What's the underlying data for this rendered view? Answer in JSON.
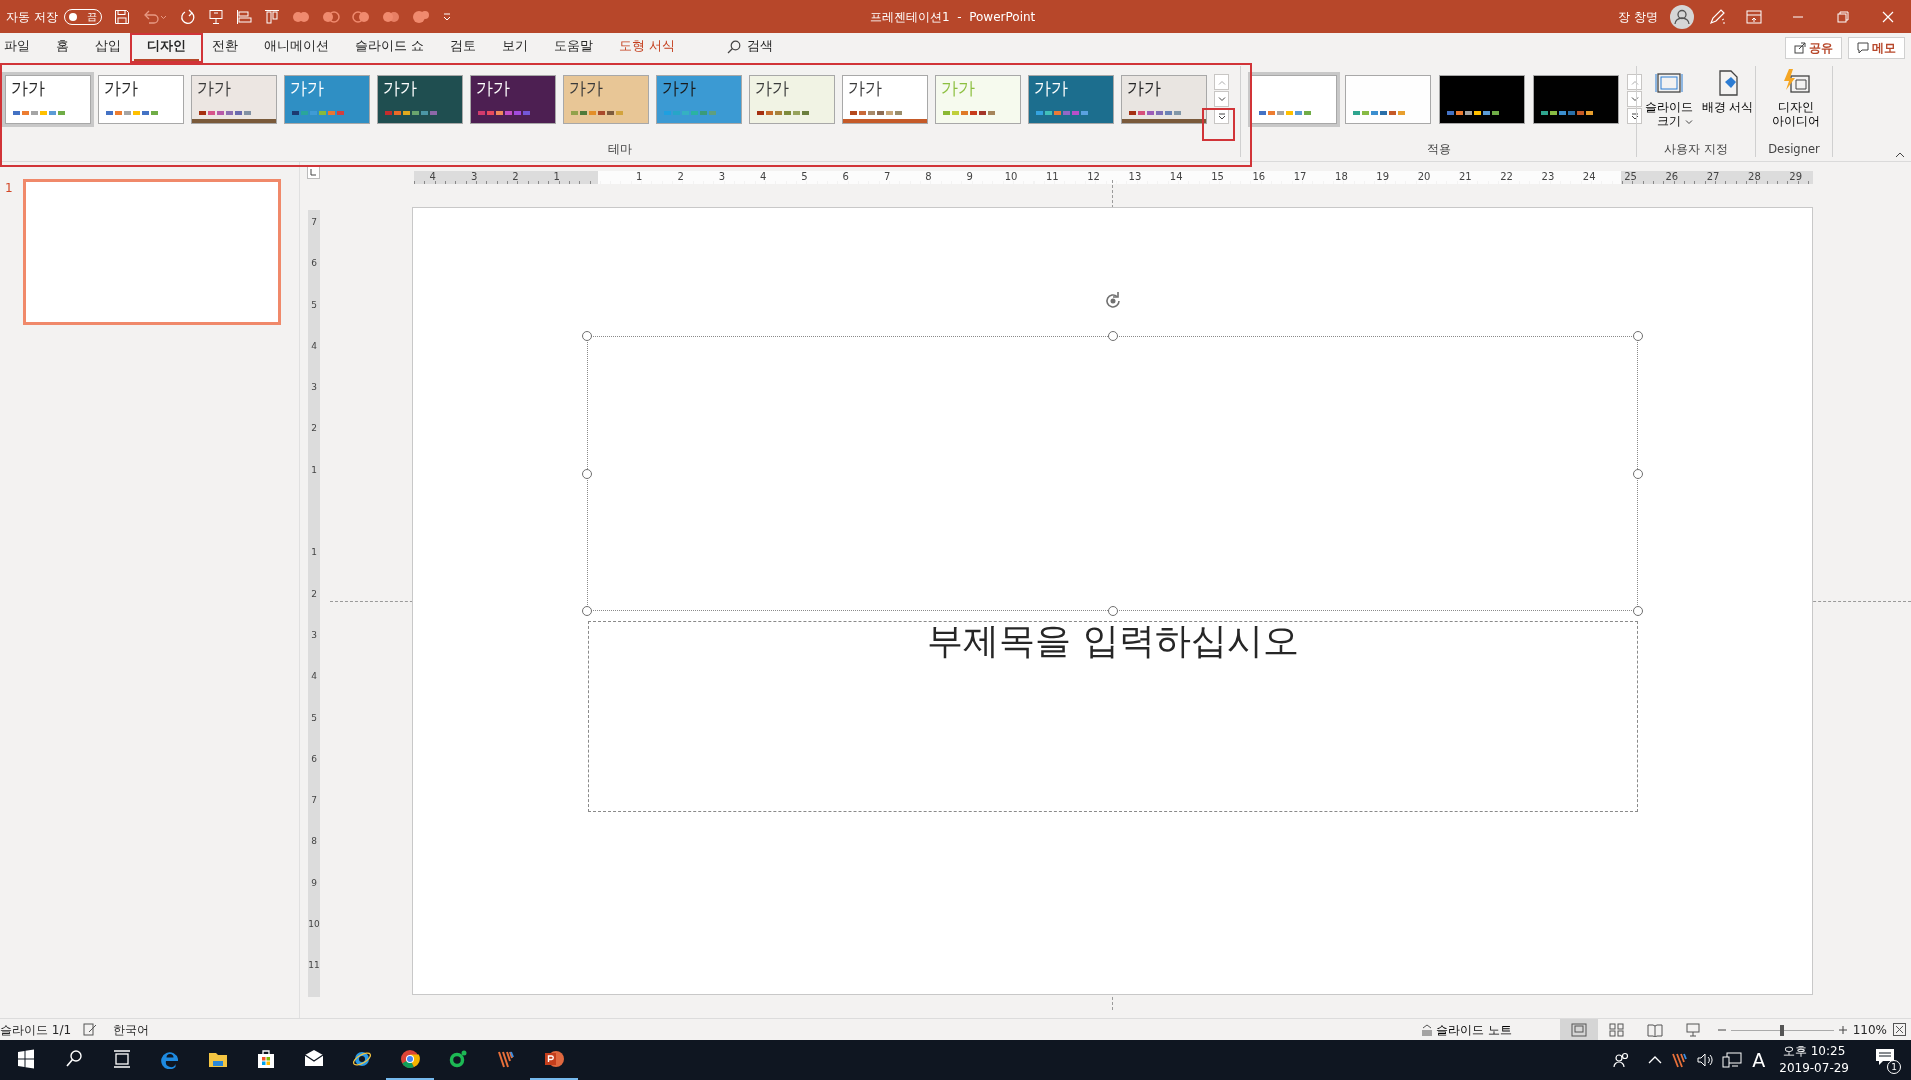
{
  "title_bar": {
    "autosave_label": "자동 저장",
    "autosave": {
      "on": false,
      "label": "끔"
    },
    "document_title": "프레젠테이션1  -  PowerPoint",
    "user_name": "장 창명"
  },
  "ribbon_tabs": [
    {
      "label": "파일",
      "selected": false,
      "kind": "normal"
    },
    {
      "label": "홈",
      "selected": false,
      "kind": "normal"
    },
    {
      "label": "삽입",
      "selected": false,
      "kind": "normal"
    },
    {
      "label": "디자인",
      "selected": true,
      "kind": "normal"
    },
    {
      "label": "전환",
      "selected": false,
      "kind": "normal"
    },
    {
      "label": "애니메이션",
      "selected": false,
      "kind": "normal"
    },
    {
      "label": "슬라이드 쇼",
      "selected": false,
      "kind": "normal"
    },
    {
      "label": "검토",
      "selected": false,
      "kind": "normal"
    },
    {
      "label": "보기",
      "selected": false,
      "kind": "normal"
    },
    {
      "label": "도움말",
      "selected": false,
      "kind": "normal"
    },
    {
      "label": "도형 서식",
      "selected": false,
      "kind": "contextual"
    }
  ],
  "search": {
    "label": "검색"
  },
  "share_button": "공유",
  "comments_button": "메모",
  "themes": {
    "label": "테마",
    "items": [
      {
        "label": {
          "text": "가가",
          "color": "#262626"
        },
        "selected": true,
        "color": "#ffffff",
        "swatches": [
          {
            "color": "#4472c4"
          },
          {
            "color": "#ed7d31"
          },
          {
            "color": "#a5a5a5"
          },
          {
            "color": "#ffc000"
          },
          {
            "color": "#5b9bd5"
          },
          {
            "color": "#70ad47"
          }
        ]
      },
      {
        "label": {
          "text": "가가",
          "color": "#262626"
        },
        "selected": false,
        "color": "#ffffff",
        "swatches": [
          {
            "color": "#4472c4"
          },
          {
            "color": "#ed7d31"
          },
          {
            "color": "#a5a5a5"
          },
          {
            "color": "#ffc000"
          },
          {
            "color": "#4473c5"
          },
          {
            "color": "#70ad47"
          }
        ]
      },
      {
        "label": {
          "text": "가가",
          "color": "#3a3a3a"
        },
        "selected": false,
        "color": "#ece6e2",
        "band": {
          "color": "#7a5a3a"
        },
        "swatches": [
          {
            "color": "#a53010"
          },
          {
            "color": "#d6558a"
          },
          {
            "color": "#b75aa9"
          },
          {
            "color": "#8c6fb1"
          },
          {
            "color": "#6a6aae"
          },
          {
            "color": "#8291a3"
          }
        ]
      },
      {
        "label": {
          "text": "가가",
          "color": "#ffffff"
        },
        "selected": false,
        "color": "#2f8fc4",
        "swatches": [
          {
            "color": "#1c3a70"
          },
          {
            "color": "#2aa69a"
          },
          {
            "color": "#3f9bd5"
          },
          {
            "color": "#88b93c"
          },
          {
            "color": "#e87633"
          },
          {
            "color": "#d13f3f"
          }
        ]
      },
      {
        "label": {
          "text": "가가",
          "color": "#ffffff"
        },
        "selected": false,
        "color": "#1f4e50",
        "swatches": [
          {
            "color": "#c22d2d"
          },
          {
            "color": "#e96b28"
          },
          {
            "color": "#e0a91e"
          },
          {
            "color": "#6aa56e"
          },
          {
            "color": "#4b96a5"
          },
          {
            "color": "#8c68a8"
          }
        ]
      },
      {
        "label": {
          "text": "가가",
          "color": "#ffffff"
        },
        "selected": false,
        "color": "#4d1f52",
        "swatches": [
          {
            "color": "#d13b6d"
          },
          {
            "color": "#e84a5f"
          },
          {
            "color": "#f08b5a"
          },
          {
            "color": "#c44ec8"
          },
          {
            "color": "#a24bde"
          },
          {
            "color": "#7358d8"
          }
        ]
      },
      {
        "label": {
          "text": "가가",
          "color": "#3a3a3a"
        },
        "selected": false,
        "color": "#e8c696",
        "swatches": [
          {
            "color": "#93a24a"
          },
          {
            "color": "#4f7a3a"
          },
          {
            "color": "#e38e27"
          },
          {
            "color": "#a94a2b"
          },
          {
            "color": "#7d5b3d"
          },
          {
            "color": "#d3a33c"
          }
        ]
      },
      {
        "label": {
          "text": "가가",
          "color": "#1a1a1a"
        },
        "selected": false,
        "color": "#3b9ad3",
        "swatches": [
          {
            "color": "#1ea0e0"
          },
          {
            "color": "#26a6c8"
          },
          {
            "color": "#35b1c2"
          },
          {
            "color": "#2ab3a2"
          },
          {
            "color": "#3a9b79"
          },
          {
            "color": "#5f9f7e"
          }
        ]
      },
      {
        "label": {
          "text": "가가",
          "color": "#3b3b3b"
        },
        "selected": false,
        "color": "#f1f3e4",
        "swatches": [
          {
            "color": "#a53011"
          },
          {
            "color": "#c56a2b"
          },
          {
            "color": "#a8823b"
          },
          {
            "color": "#7f8b3c"
          },
          {
            "color": "#98a35c"
          },
          {
            "color": "#6c7f3f"
          }
        ]
      },
      {
        "label": {
          "text": "가가",
          "color": "#3a3a3b"
        },
        "selected": false,
        "color": "#ffffff",
        "band": {
          "color": "#c55a28"
        },
        "swatches": [
          {
            "color": "#b5491e"
          },
          {
            "color": "#c96a3a"
          },
          {
            "color": "#a88a6a"
          },
          {
            "color": "#8f6d54"
          },
          {
            "color": "#c7a67a"
          },
          {
            "color": "#9b8e6c"
          }
        ]
      },
      {
        "label": {
          "text": "가가",
          "color": "#8cbf3f"
        },
        "selected": false,
        "color": "#f6faee",
        "swatches": [
          {
            "color": "#8ab833"
          },
          {
            "color": "#c0cf3a"
          },
          {
            "color": "#e07a27"
          },
          {
            "color": "#c83c1c"
          },
          {
            "color": "#a4372a"
          },
          {
            "color": "#a6855b"
          }
        ]
      },
      {
        "label": {
          "text": "가가",
          "color": "#fffffe"
        },
        "selected": false,
        "color": "#1c6e8e",
        "swatches": [
          {
            "color": "#34a3e0"
          },
          {
            "color": "#40c0b8"
          },
          {
            "color": "#ea7a36"
          },
          {
            "color": "#9068c6"
          },
          {
            "color": "#b64fc8"
          },
          {
            "color": "#5aa1e0"
          }
        ]
      },
      {
        "label": {
          "text": "가가",
          "color": "#262627"
        },
        "selected": false,
        "color": "#e9e5e1",
        "band": {
          "color": "#7a5a3b"
        },
        "swatches": [
          {
            "color": "#a53012"
          },
          {
            "color": "#d64f7a"
          },
          {
            "color": "#9c5db9"
          },
          {
            "color": "#7f6fb6"
          },
          {
            "color": "#6a82b5"
          },
          {
            "color": "#8297a8"
          }
        ]
      }
    ]
  },
  "variants": {
    "label": "적용",
    "items": [
      {
        "selected": true,
        "color": "#ffffff",
        "swatches": [
          {
            "color": "#4472c4"
          },
          {
            "color": "#ed7d31"
          },
          {
            "color": "#a5a5a5"
          },
          {
            "color": "#ffc000"
          },
          {
            "color": "#5b9bd5"
          },
          {
            "color": "#70ad47"
          }
        ]
      },
      {
        "selected": false,
        "color": "#fefefe",
        "swatches": [
          {
            "color": "#2fa58f"
          },
          {
            "color": "#88bb44"
          },
          {
            "color": "#3c8fcf"
          },
          {
            "color": "#2a6fa8"
          },
          {
            "color": "#c55a28"
          },
          {
            "color": "#e89f2e"
          }
        ]
      },
      {
        "selected": false,
        "color": "#000000",
        "swatches": [
          {
            "color": "#4472c4"
          },
          {
            "color": "#ed7d31"
          },
          {
            "color": "#a5a5a5"
          },
          {
            "color": "#ffc000"
          },
          {
            "color": "#5b9bd5"
          },
          {
            "color": "#70ad47"
          }
        ]
      },
      {
        "selected": false,
        "color": "#010101",
        "swatches": [
          {
            "color": "#2fa58f"
          },
          {
            "color": "#88bb44"
          },
          {
            "color": "#3c8fcf"
          },
          {
            "color": "#2a6fa8"
          },
          {
            "color": "#c55a28"
          },
          {
            "color": "#e89f2e"
          }
        ]
      }
    ]
  },
  "customize": {
    "label": "사용자 지정",
    "buttons": [
      {
        "label": "슬라이드 크기",
        "kind": "slide-size",
        "dropdown": true
      },
      {
        "label": "배경 서식",
        "kind": "background",
        "dropdown": false
      }
    ]
  },
  "designer": {
    "label": "Designer",
    "buttons": [
      {
        "label": "디자인 아이디어",
        "kind": "design-ideas",
        "dropdown": false
      }
    ]
  },
  "slides_pane": [
    {
      "number": "1",
      "selected": true
    }
  ],
  "rulers": {
    "horizontal": {
      "before": [
        "4",
        "3",
        "2",
        "1"
      ],
      "after": [
        "1",
        "2",
        "3",
        "4",
        "5",
        "6",
        "7",
        "8",
        "9",
        "10",
        "11",
        "12",
        "13",
        "14",
        "15",
        "16",
        "17",
        "18",
        "19",
        "20",
        "21",
        "22",
        "23",
        "24",
        "25",
        "26",
        "27",
        "28",
        "29"
      ]
    },
    "vertical": {
      "before": [
        "7",
        "6",
        "5",
        "4",
        "3",
        "2",
        "1"
      ],
      "after": [
        "1",
        "2",
        "3",
        "4",
        "5",
        "6",
        "7",
        "8",
        "9",
        "10",
        "11"
      ]
    }
  },
  "slide": {
    "placeholders": [
      {
        "kind": "title",
        "selected": true
      },
      {
        "kind": "subtitle",
        "selected": false,
        "text": "부제목을 입력하십시오"
      }
    ]
  },
  "status_bar": {
    "slide_count": "슬라이드 1/1",
    "language": "한국어",
    "notes": "슬라이드 노트",
    "views": [
      {
        "kind": "normal",
        "selected": true
      },
      {
        "kind": "sorter",
        "selected": false
      },
      {
        "kind": "reading",
        "selected": false
      },
      {
        "kind": "slideshow",
        "selected": false
      }
    ],
    "zoom": {
      "level": 0.5,
      "reading": "110%"
    }
  },
  "taskbar": {
    "apps": [
      {
        "kind": "start",
        "running": false
      },
      {
        "kind": "search",
        "running": false
      },
      {
        "kind": "taskview",
        "running": false
      },
      {
        "kind": "edge",
        "running": false
      },
      {
        "kind": "explorer",
        "running": false
      },
      {
        "kind": "store",
        "running": false
      },
      {
        "kind": "mail",
        "running": false
      },
      {
        "kind": "ie",
        "running": false
      },
      {
        "kind": "chrome",
        "running": true
      },
      {
        "kind": "green",
        "running": false
      },
      {
        "kind": "stripes",
        "running": false
      },
      {
        "kind": "powerpoint",
        "running": true
      }
    ],
    "tray": {
      "ime": "A",
      "time": "오후 10:25",
      "date": "2019-07-29",
      "notifications": "1"
    }
  },
  "annotation_frames": [
    {
      "kind": "tab"
    },
    {
      "kind": "gallery"
    },
    {
      "kind": "more"
    }
  ]
}
